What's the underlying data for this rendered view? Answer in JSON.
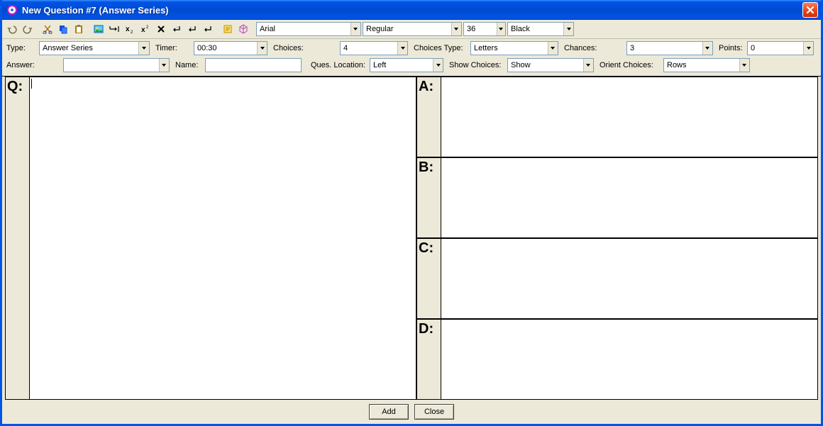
{
  "window": {
    "title": "New Question #7 (Answer Series)"
  },
  "toolbar": {
    "font_family": "Arial",
    "font_style": "Regular",
    "font_size": "36",
    "font_color": "Black"
  },
  "config": {
    "type_label": "Type:",
    "type_value": "Answer Series",
    "timer_label": "Timer:",
    "timer_value": "00:30",
    "choices_label": "Choices:",
    "choices_value": "4",
    "choices_type_label": "Choices Type:",
    "choices_type_value": "Letters",
    "chances_label": "Chances:",
    "chances_value": "3",
    "points_label": "Points:",
    "points_value": "0",
    "answer_label": "Answer:",
    "answer_value": "",
    "name_label": "Name:",
    "name_value": "",
    "ques_loc_label": "Ques. Location:",
    "ques_loc_value": "Left",
    "show_choices_label": "Show Choices:",
    "show_choices_value": "Show",
    "orient_choices_label": "Orient Choices:",
    "orient_choices_value": "Rows"
  },
  "editor": {
    "q_label": "Q:",
    "answers": [
      "A:",
      "B:",
      "C:",
      "D:"
    ]
  },
  "footer": {
    "add": "Add",
    "close": "Close"
  }
}
